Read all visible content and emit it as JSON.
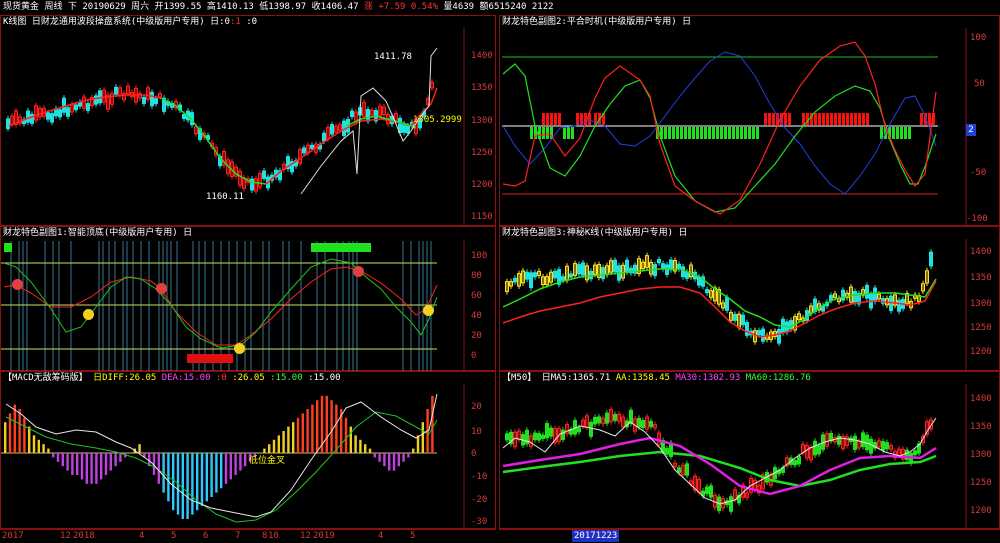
{
  "header": {
    "instrument": "现货黄金",
    "period": "周线",
    "mode": "下",
    "date": "20190629",
    "weekday": "周六",
    "open": "开1399.55",
    "high": "高1410.13",
    "low": "低1398.97",
    "close": "收1406.47",
    "change": "涨 +7.59",
    "change_pct": "0.54%",
    "volume": "量4639",
    "amount": "额6515240",
    "extra": "2122"
  },
  "panels": {
    "kline": {
      "title": "K线图",
      "indicator": "日财龙通用波段操盘系统(中级版用户专用)",
      "suffix": "日:0",
      "suffix2": ":1",
      "suffix3": ":0",
      "label_high": "1411.78",
      "label_low": "1160.11",
      "label_price": "1305.2999",
      "yticks": [
        "1400",
        "1350",
        "1300",
        "1250",
        "1200",
        "1150"
      ]
    },
    "sub2": {
      "title": "财龙特色副图2:平合时机(中级版用户专用)",
      "suffix": "日",
      "yticks": [
        "100",
        "50",
        "0",
        "-50",
        "-100"
      ],
      "badge": "2"
    },
    "sub1": {
      "title": "财龙特色副图1:智能顶底(中级版用户专用)",
      "suffix": "日",
      "yticks": [
        "100",
        "80",
        "60",
        "40",
        "20",
        "0"
      ]
    },
    "sub3": {
      "title": "财龙特色副图3:神秘K线(中级版用户专用)",
      "suffix": "日",
      "yticks": [
        "1400",
        "1350",
        "1300",
        "1250",
        "1200"
      ]
    },
    "macd": {
      "title": "【MACD无敌筹码版】",
      "diff": "日DIFF:26.05",
      "dea": "DEA:15.00",
      "v0": ":0",
      "v1": ":26.05",
      "v2": ":15.00",
      "v3": ":15.00",
      "annotation": "低位金叉",
      "yticks": [
        "20",
        "10",
        "0",
        "-10",
        "-20",
        "-30"
      ]
    },
    "ma": {
      "title": "【M50】",
      "ma5": "日MA5:1365.71",
      "aa": "AA:1358.45",
      "ma30": "MA30:1302.93",
      "ma60": "MA60:1286.76",
      "yticks": [
        "1400",
        "1350",
        "1300",
        "1250",
        "1200"
      ]
    }
  },
  "xaxis": {
    "labels": [
      "2017",
      "12",
      "2018",
      "4",
      "5",
      "6",
      "7",
      "8",
      "9",
      "10",
      "12",
      "2019",
      "4",
      "5"
    ],
    "cursor_date": "20171223"
  }
}
